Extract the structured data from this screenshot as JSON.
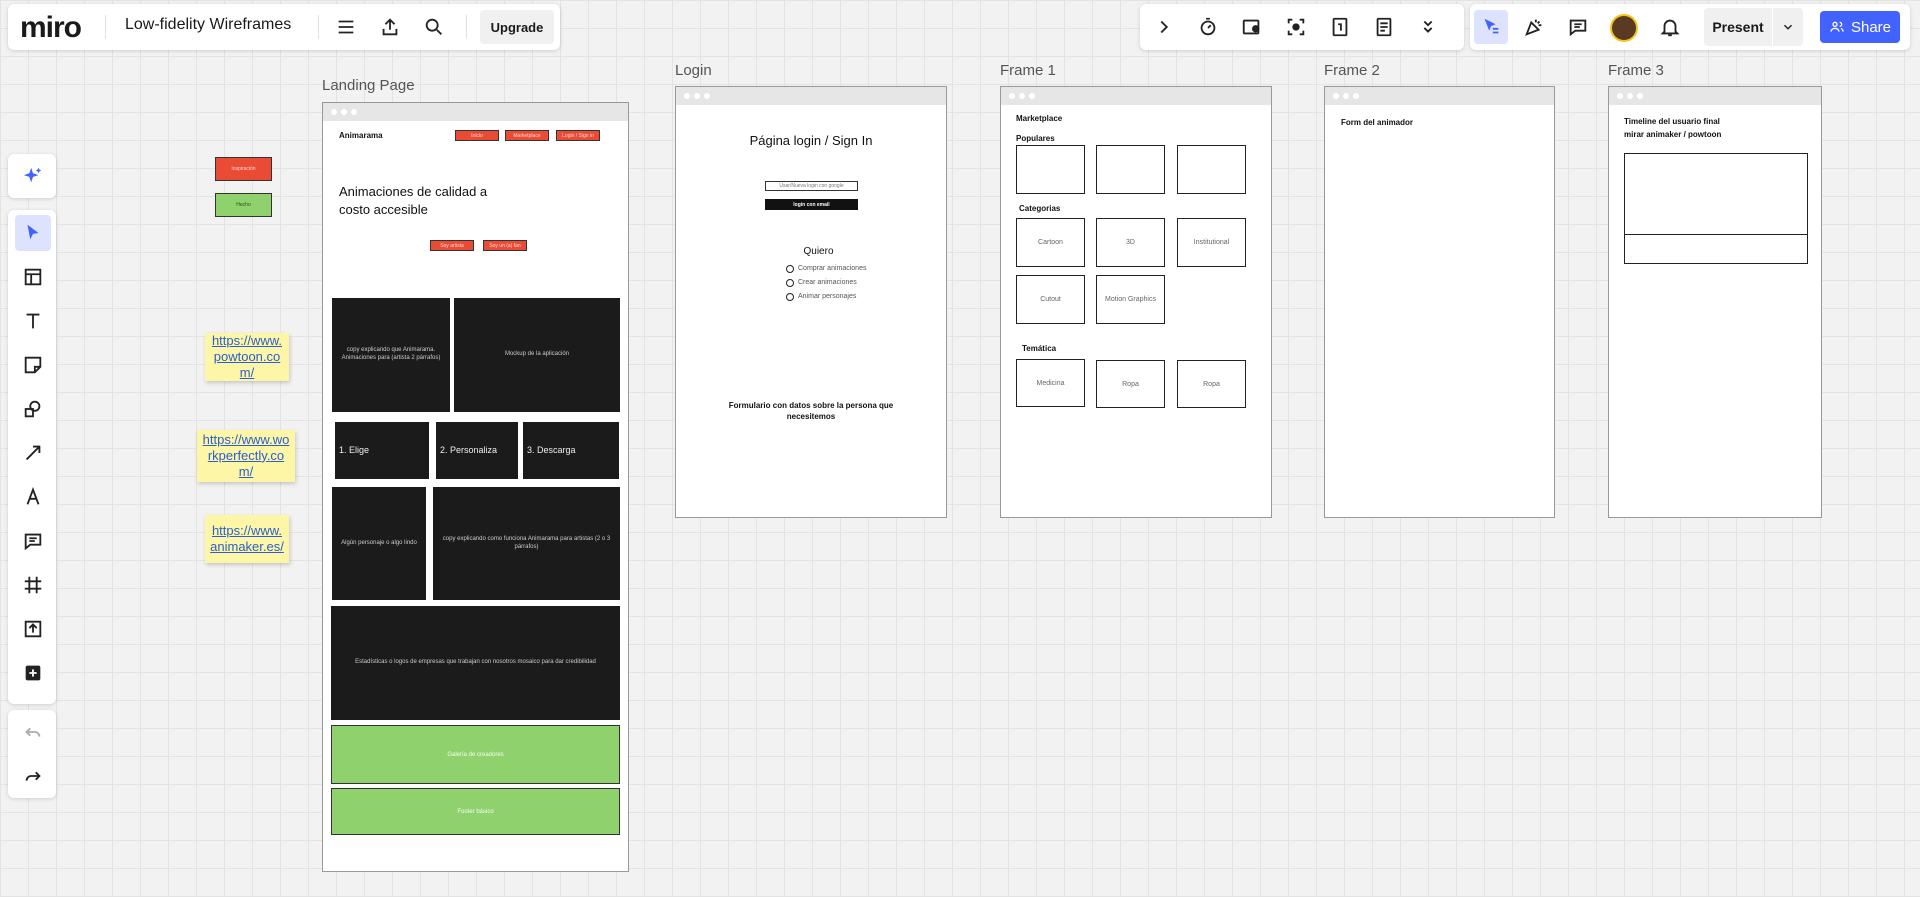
{
  "app": {
    "logo": "miro",
    "board_title": "Low-fidelity Wireframes",
    "upgrade_label": "Upgrade",
    "present_label": "Present",
    "share_label": "Share",
    "accent": "#4262ff"
  },
  "left_toolbar": {
    "tools": [
      "ai-sparkle-icon",
      "select-icon",
      "templates-icon",
      "text-icon",
      "sticky-note-icon",
      "shapes-icon",
      "connection-line-icon",
      "pen-icon",
      "comment-icon",
      "frame-icon",
      "upload-icon",
      "more-apps-icon",
      "undo-icon",
      "redo-icon"
    ]
  },
  "stickies": [
    "https://www.powtoon.com/",
    "https://www.workperfectly.com/",
    "https://www.animaker.es/"
  ],
  "tags": {
    "red": "Inspiración",
    "green": "Hecho"
  },
  "frames": {
    "landing": {
      "label": "Landing Page",
      "brand": "Animarama",
      "nav": [
        "Inicio",
        "Marketplace",
        "Login / Sign in"
      ],
      "headline": "Animaciones de calidad a costo accesible",
      "cta": [
        "Soy artista",
        "Soy un (a) fan"
      ],
      "block1": "copy explicando que Animarama. Animaciones para (artista 2 párrafos)",
      "block2": "Mockup de la aplicación",
      "steps": [
        "1. Elige",
        "2. Personaliza",
        "3. Descarga"
      ],
      "block3": "Algún personaje o algo lindo",
      "block4": "copy explicando como funciona Animarama para artistas (2 o 3 párrafos)",
      "block5": "Estadísticas o logos de empresas que trabajan con nosotros mosaico para dar credibilidad",
      "green1": "Galería de creadores",
      "green2": "Footer básico"
    },
    "login": {
      "label": "Login",
      "title": "Página login / Sign In",
      "input": "Usar/Nueva login con google",
      "button": "login con email",
      "quiero": "Quiero",
      "options": [
        "Comprar animaciones",
        "Crear animaciones",
        "Animar personajes"
      ],
      "footer": "Formulario con datos sobre la persona que necesitemos"
    },
    "frame1": {
      "label": "Frame 1",
      "title": "Marketplace",
      "populares": "Populares",
      "categorias": "Categorias",
      "cats": [
        "Cartoon",
        "3D",
        "Institutional",
        "Cutout",
        "Motion Graphics"
      ],
      "tematica": "Temática",
      "temas": [
        "Medicina",
        "Ropa",
        "Ropa"
      ]
    },
    "frame2": {
      "label": "Frame 2",
      "text": "Form del animador"
    },
    "frame3": {
      "label": "Frame 3",
      "title": "Timeline del usuario final",
      "subtitle": "mirar animaker / powtoon"
    }
  }
}
